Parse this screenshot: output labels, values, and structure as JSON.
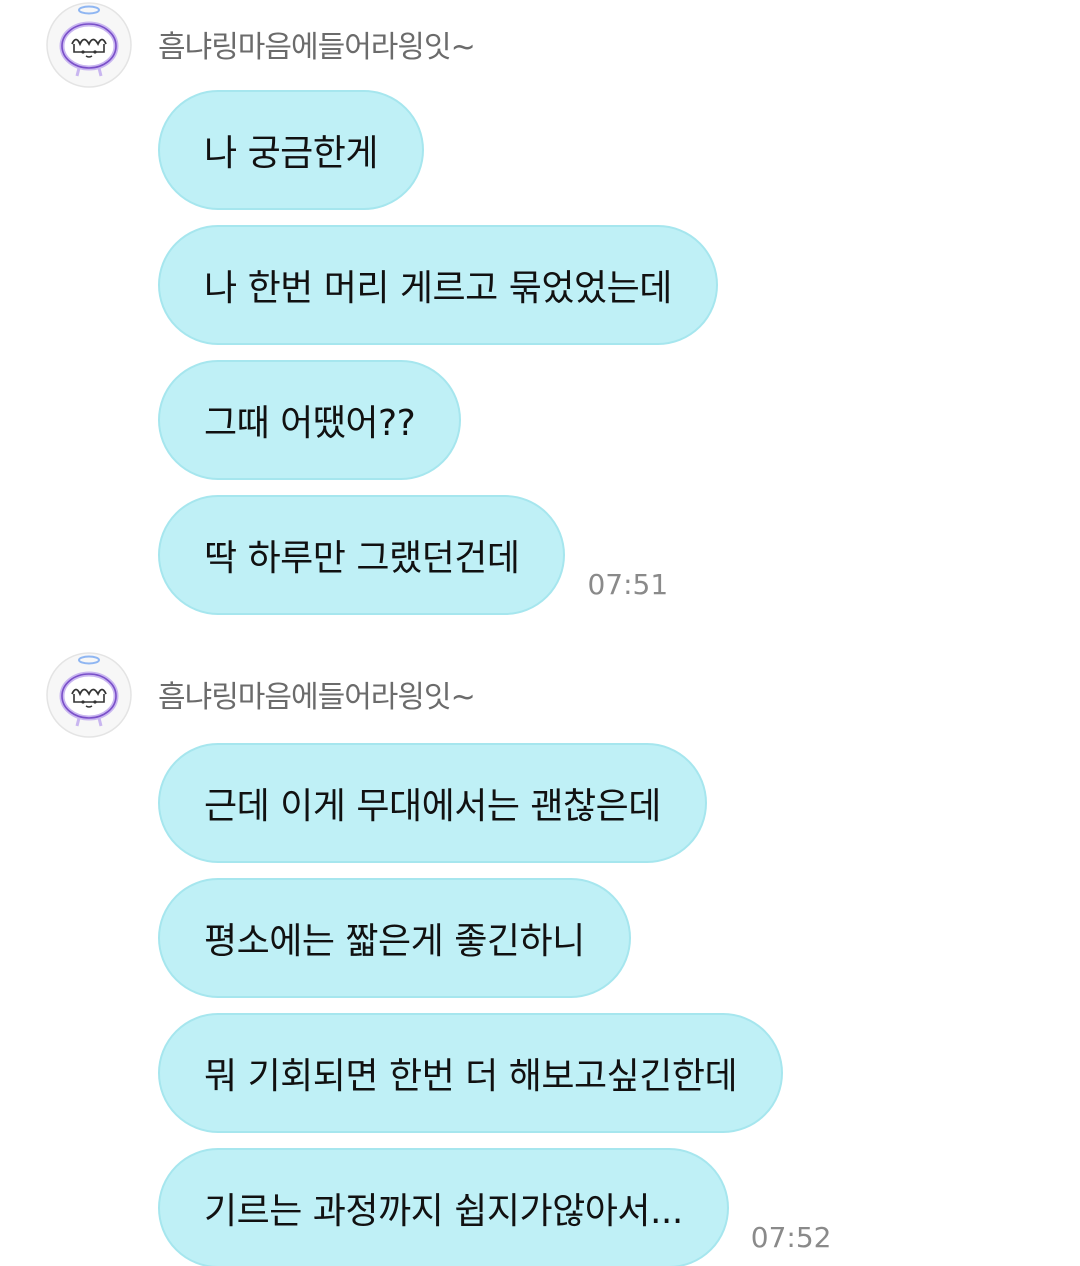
{
  "groups": [
    {
      "sender": "흠냐링마음에들어라읭잇~",
      "messages": [
        "나 궁금한게",
        "나 한번 머리 게르고 묶었었는데",
        "그때 어땠어??",
        "딱 하루만 그랬던건데"
      ],
      "time": "07:51"
    },
    {
      "sender": "흠냐링마음에들어라읭잇~",
      "messages": [
        "근데 이게 무대에서는 괜찮은데",
        "평소에는 짧은게 좋긴하니",
        "뭐 기회되면 한번 더 해보고싶긴한데",
        "기르는 과정까지 쉽지가않아서..."
      ],
      "time": "07:52"
    }
  ],
  "colors": {
    "bubble_fill": "#bff0f6",
    "bubble_border": "#a6e6ee",
    "avatar_ring": "#c9b6f0",
    "avatar_line": "#7a4fc9"
  },
  "icons": {
    "avatar": "angel-character-avatar-icon"
  }
}
